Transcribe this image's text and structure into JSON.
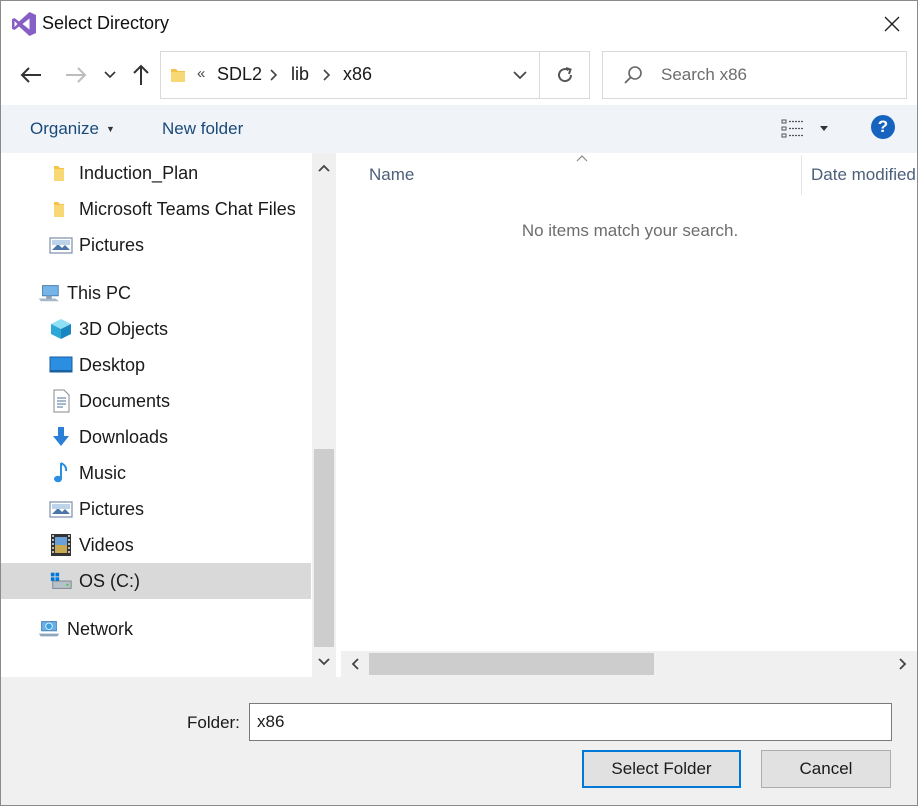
{
  "window": {
    "title": "Select Directory"
  },
  "address": {
    "overflow": "«",
    "crumbs": [
      "SDL2",
      "lib",
      "x86"
    ]
  },
  "search": {
    "placeholder": "Search x86"
  },
  "toolbar": {
    "organize_label": "Organize",
    "new_folder_label": "New folder",
    "help_label": "?"
  },
  "nav": {
    "items": [
      {
        "label": "Induction_Plan",
        "icon": "folder-icon"
      },
      {
        "label": "Microsoft Teams Chat Files",
        "icon": "folder-icon"
      },
      {
        "label": "Pictures",
        "icon": "pictures-icon"
      },
      {
        "label": "This PC",
        "icon": "computer-icon"
      },
      {
        "label": "3D Objects",
        "icon": "3d-objects-icon"
      },
      {
        "label": "Desktop",
        "icon": "desktop-icon"
      },
      {
        "label": "Documents",
        "icon": "documents-icon"
      },
      {
        "label": "Downloads",
        "icon": "downloads-icon"
      },
      {
        "label": "Music",
        "icon": "music-icon"
      },
      {
        "label": "Pictures",
        "icon": "pictures-icon"
      },
      {
        "label": "Videos",
        "icon": "videos-icon"
      },
      {
        "label": "OS (C:)",
        "icon": "drive-icon"
      },
      {
        "label": "Network",
        "icon": "network-icon"
      }
    ],
    "selected": "OS (C:)"
  },
  "filelist": {
    "columns": [
      "Name",
      "Date modified"
    ],
    "empty_message": "No items match your search."
  },
  "footer": {
    "folder_label": "Folder:",
    "folder_value": "x86",
    "select_button": "Select Folder",
    "cancel_button": "Cancel"
  },
  "colors": {
    "accent": "#0078d7",
    "help": "#1764c0",
    "folder": "#f4c34a",
    "toolbar_bg": "#f0f4f9",
    "selected_bg": "#d9d9d9"
  }
}
